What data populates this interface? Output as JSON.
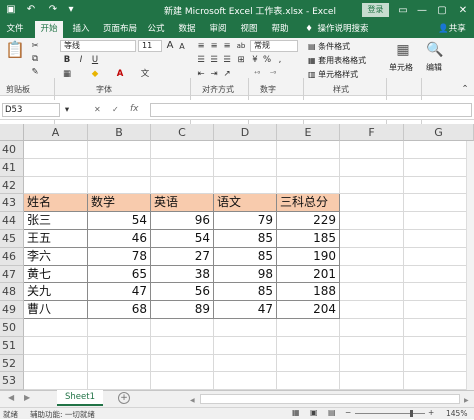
{
  "title": "新建 Microsoft Excel 工作表.xlsx  -  Excel",
  "login_label": "登录",
  "accent": "#217346",
  "tabs": [
    "文件",
    "开始",
    "插入",
    "页面布局",
    "公式",
    "数据",
    "审阅",
    "视图",
    "帮助",
    "操作说明搜索",
    "共享"
  ],
  "ribbon": {
    "font_name": "等线",
    "font_size": "11",
    "number_format": "常规",
    "cond_format": "条件格式",
    "table_format": "套用表格格式",
    "cell_style": "单元格样式",
    "cells_label": "单元格",
    "edit_label": "编辑",
    "font_a_large": "A",
    "font_a_small": "A",
    "align_wrap": "ab",
    "groups": [
      "剪贴板",
      "字体",
      "对齐方式",
      "数字",
      "样式"
    ]
  },
  "formula_bar": {
    "name_box": "D53",
    "fx": "fx"
  },
  "columns": [
    "A",
    "B",
    "C",
    "D",
    "E",
    "F",
    "G"
  ],
  "rows": [
    {
      "n": "40",
      "cells": [
        "",
        "",
        "",
        "",
        ""
      ]
    },
    {
      "n": "41",
      "cells": [
        "",
        "",
        "",
        "",
        ""
      ]
    },
    {
      "n": "42",
      "cells": [
        "",
        "",
        "",
        "",
        ""
      ]
    },
    {
      "n": "43",
      "cells": [
        "姓名",
        "数学",
        "英语",
        "语文",
        "三科总分"
      ]
    },
    {
      "n": "44",
      "cells": [
        "张三",
        "54",
        "96",
        "79",
        "229"
      ]
    },
    {
      "n": "45",
      "cells": [
        "王五",
        "46",
        "54",
        "85",
        "185"
      ]
    },
    {
      "n": "46",
      "cells": [
        "李六",
        "78",
        "27",
        "85",
        "190"
      ]
    },
    {
      "n": "47",
      "cells": [
        "黄七",
        "65",
        "38",
        "98",
        "201"
      ]
    },
    {
      "n": "48",
      "cells": [
        "关九",
        "47",
        "56",
        "85",
        "188"
      ]
    },
    {
      "n": "49",
      "cells": [
        "曹八",
        "68",
        "89",
        "47",
        "204"
      ]
    },
    {
      "n": "50",
      "cells": [
        "",
        "",
        "",
        "",
        ""
      ]
    },
    {
      "n": "51",
      "cells": [
        "",
        "",
        "",
        "",
        ""
      ]
    },
    {
      "n": "52",
      "cells": [
        "",
        "",
        "",
        "",
        ""
      ]
    },
    {
      "n": "53",
      "cells": [
        "",
        "",
        "",
        "",
        ""
      ]
    }
  ],
  "sheet_tab": "Sheet1",
  "status": {
    "ready": "就绪",
    "accessibility": "辅助功能: 一切就绪",
    "zoom": "145%"
  }
}
